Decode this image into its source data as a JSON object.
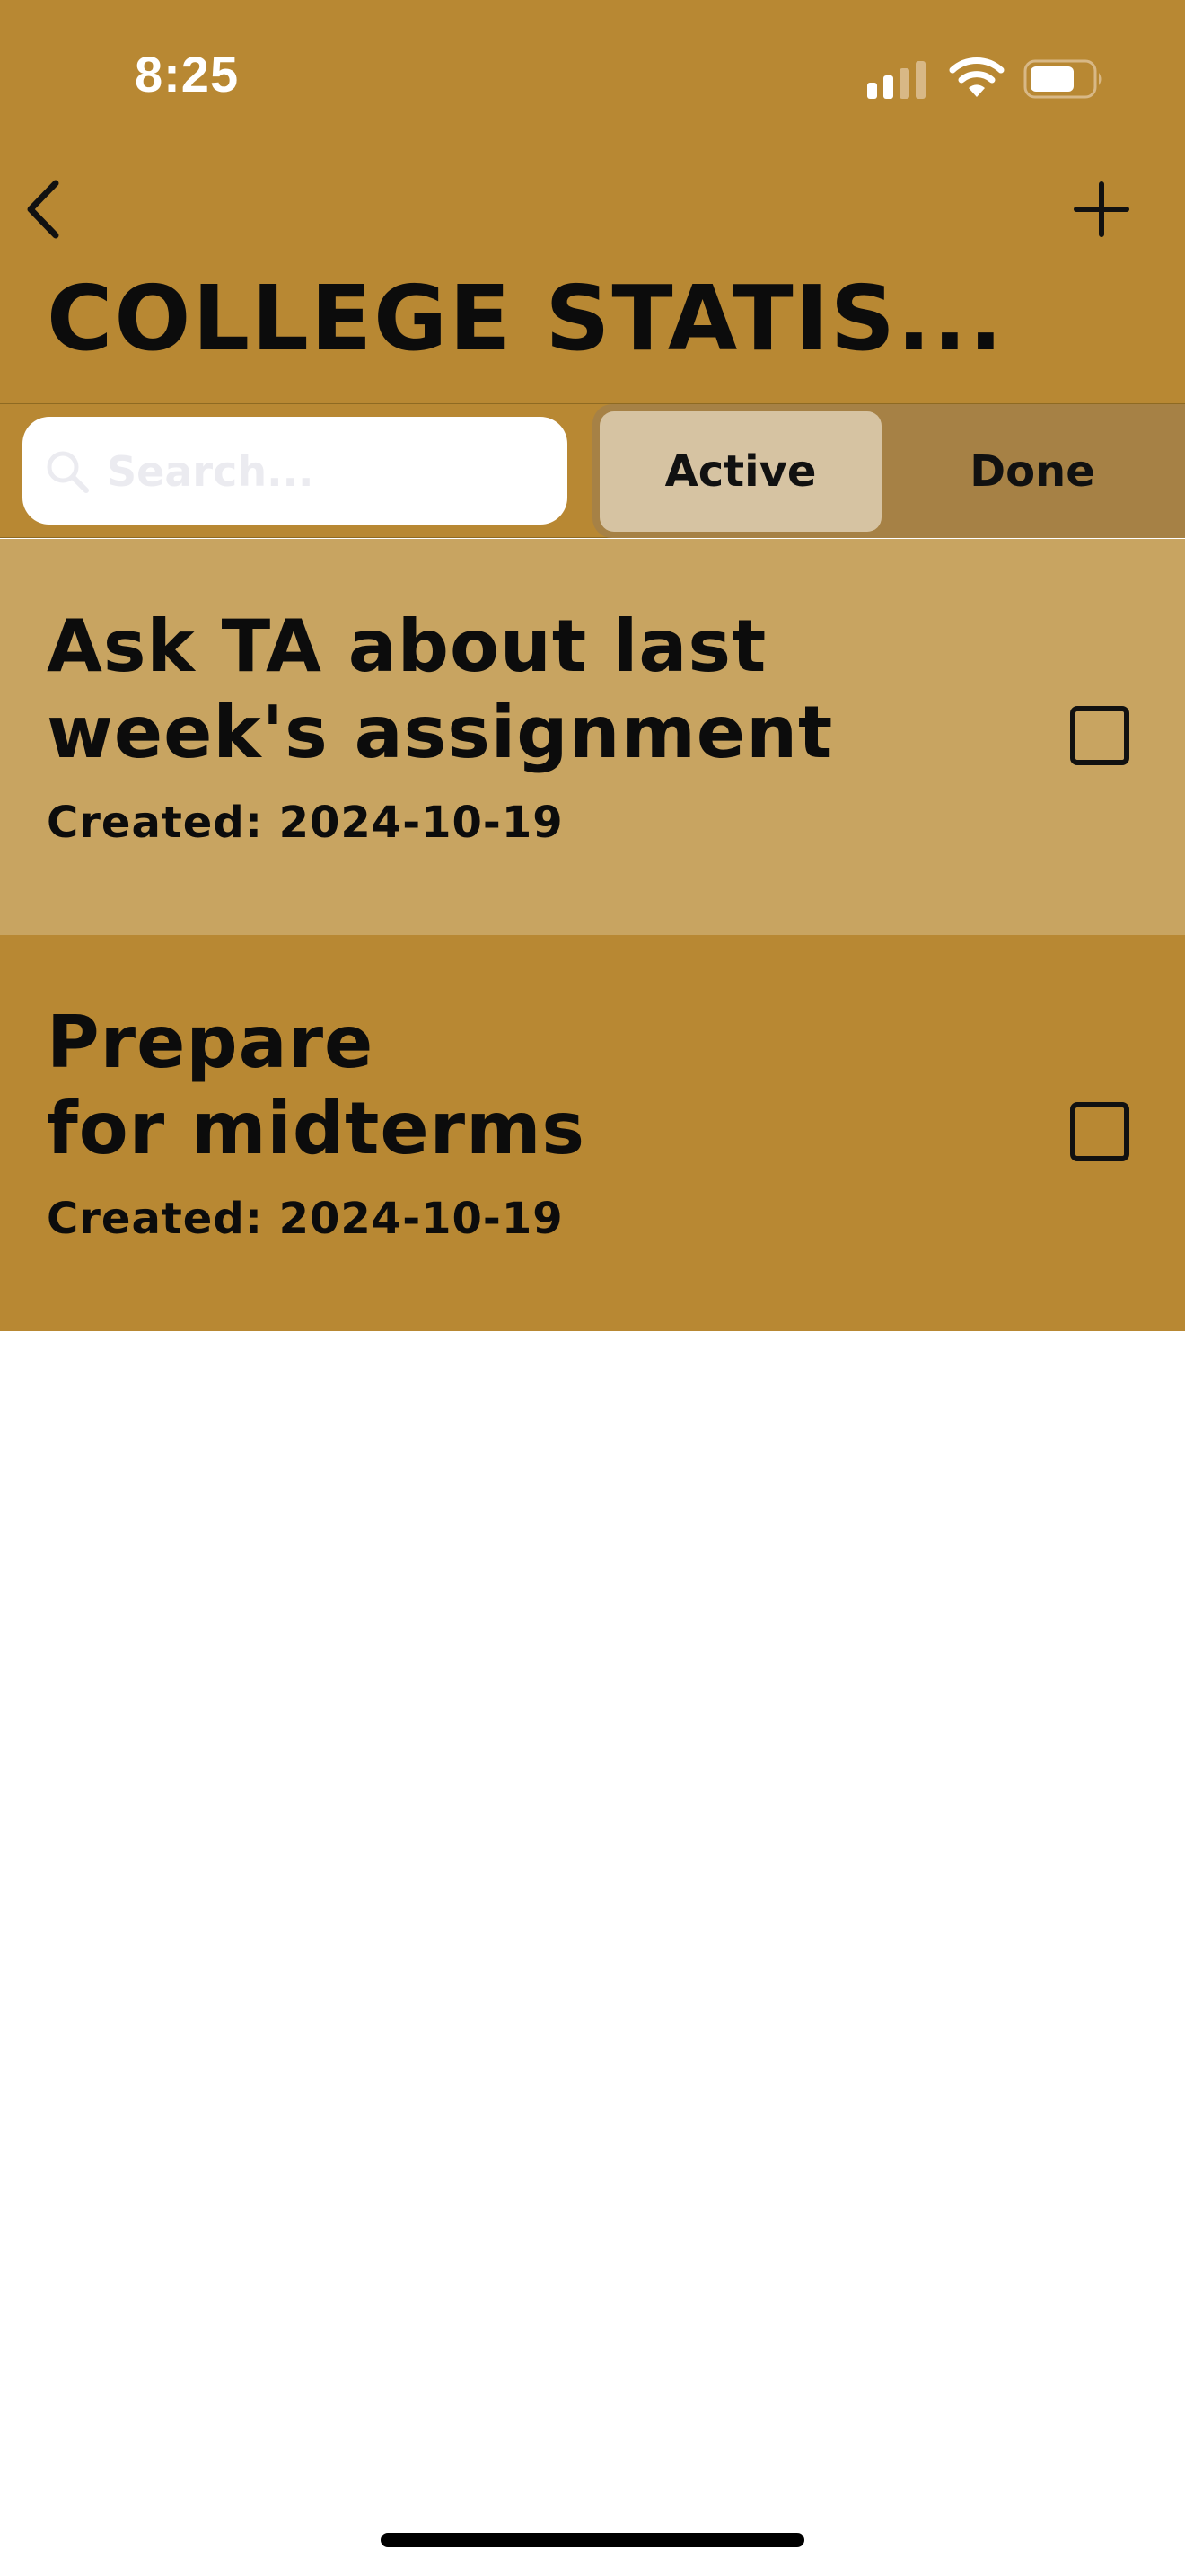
{
  "colors": {
    "header_bg": "#b88833",
    "toolbar_bg": "#b88833",
    "segmented_bg": "#a68145",
    "segment_active_bg": "#d6c3a2",
    "task_highlight_bg": "#c8a461",
    "task_default_bg": "#b88833",
    "text": "#0c0c0c",
    "placeholder": "#ebebf0",
    "page_bg": "#ffffff"
  },
  "status_bar": {
    "time": "8:25",
    "signal_icon": "cellular-signal-icon",
    "wifi_icon": "wifi-icon",
    "battery_icon": "battery-icon"
  },
  "nav": {
    "back_icon": "chevron-left-icon",
    "add_icon": "plus-icon",
    "title": "COLLEGE STATIS..."
  },
  "search": {
    "placeholder": "Search...",
    "value": "",
    "icon": "search-icon"
  },
  "filter": {
    "segments": [
      {
        "label": "Active",
        "selected": true
      },
      {
        "label": "Done",
        "selected": false
      }
    ]
  },
  "tasks": [
    {
      "title": "Ask TA about last\nweek's assignment",
      "created": "Created: 2024-10-19",
      "checked": false,
      "highlighted": true
    },
    {
      "title": "Prepare\nfor midterms",
      "created": "Created: 2024-10-19",
      "checked": false,
      "highlighted": false
    }
  ]
}
